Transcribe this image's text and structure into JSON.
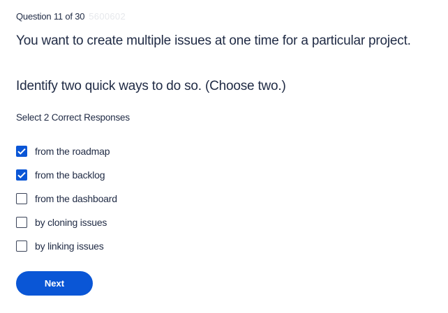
{
  "header": {
    "counter_label": "Question 11 of 30",
    "faded_id": "5600602"
  },
  "question": {
    "line1": "You want to create multiple issues at one time for a particular project.",
    "line2": "Identify two quick ways to do so. (Choose two.)"
  },
  "instruction": "Select 2 Correct Responses",
  "options": [
    {
      "label": "from the roadmap",
      "checked": true
    },
    {
      "label": "from the backlog",
      "checked": true
    },
    {
      "label": "from the dashboard",
      "checked": false
    },
    {
      "label": "by cloning issues",
      "checked": false
    },
    {
      "label": "by linking issues",
      "checked": false
    }
  ],
  "actions": {
    "next_label": "Next"
  },
  "colors": {
    "accent": "#0a56d6",
    "text": "#1f2a44"
  },
  "icons": {
    "checked": "checkmark-icon"
  }
}
